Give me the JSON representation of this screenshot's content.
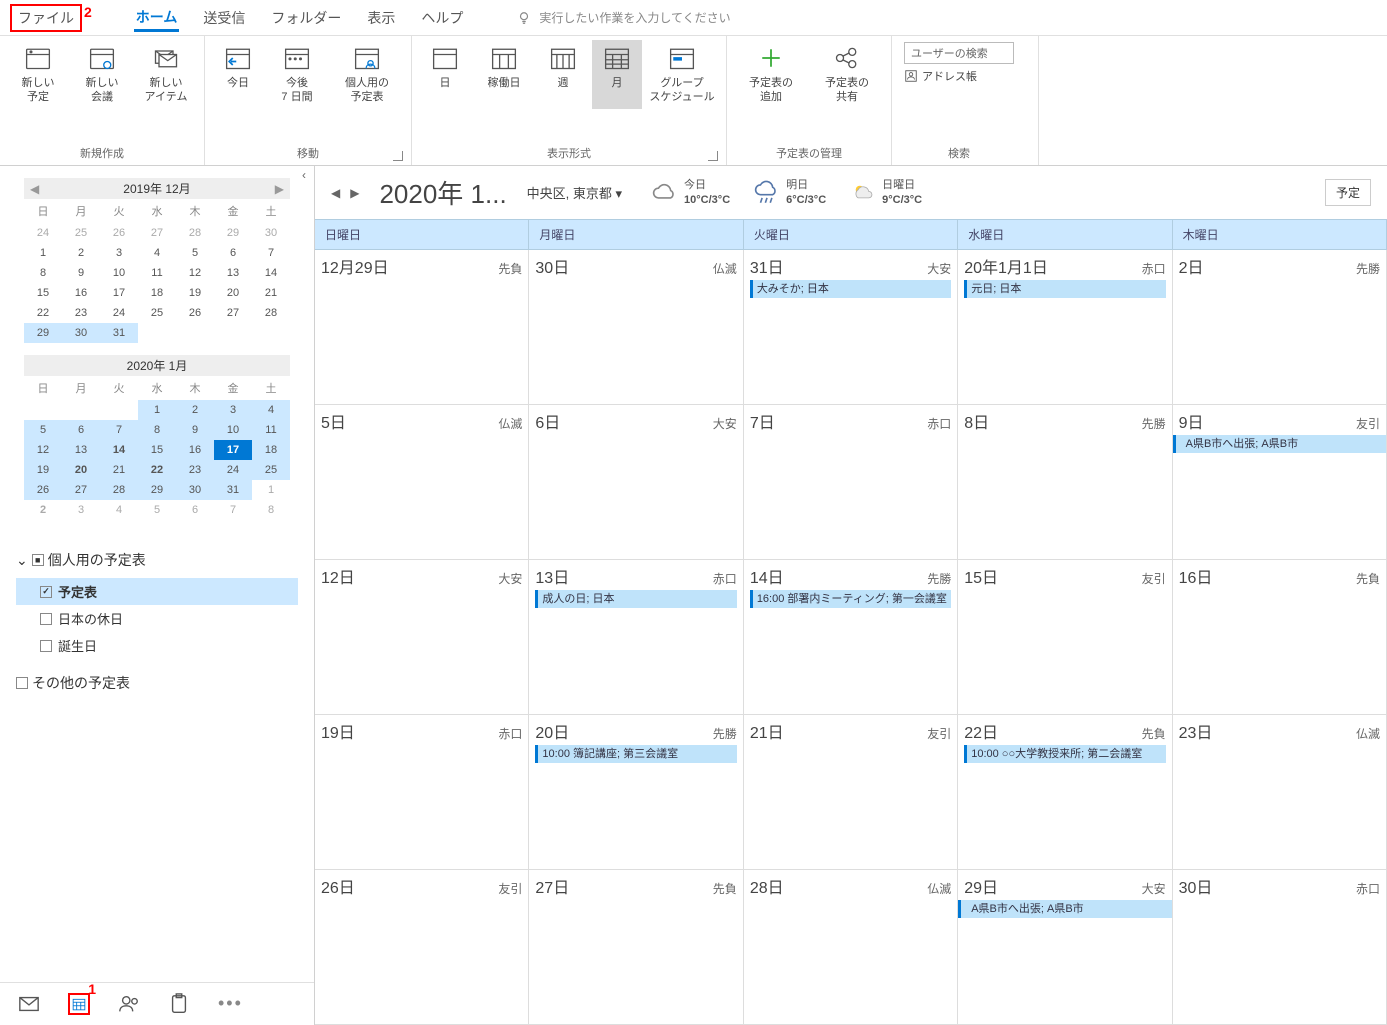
{
  "annotations": {
    "file_num": "2",
    "cal_num": "1"
  },
  "menu": {
    "file": "ファイル",
    "home": "ホーム",
    "sendreceive": "送受信",
    "folder": "フォルダー",
    "view": "表示",
    "help": "ヘルプ",
    "tellme": "実行したい作業を入力してください"
  },
  "ribbon": {
    "new": {
      "label": "新規作成",
      "appt": "新しい\n予定",
      "meeting": "新しい\n会議",
      "items": "新しい\nアイテム"
    },
    "goto": {
      "label": "移動",
      "today": "今日",
      "next7": "今後\n7 日間",
      "personal": "個人用の\n予定表"
    },
    "arrange": {
      "label": "表示形式",
      "day": "日",
      "workweek": "稼働日",
      "week": "週",
      "month": "月",
      "group": "グループ\nスケジュール"
    },
    "manage": {
      "label": "予定表の管理",
      "add": "予定表の\n追加",
      "share": "予定表の\n共有"
    },
    "search": {
      "label": "検索",
      "placeholder": "ユーザーの検索",
      "address": "アドレス帳"
    }
  },
  "minical1": {
    "title": "2019年 12月",
    "dow": [
      "日",
      "月",
      "火",
      "水",
      "木",
      "金",
      "土"
    ],
    "rows": [
      [
        "24",
        "25",
        "26",
        "27",
        "28",
        "29",
        "30"
      ],
      [
        "1",
        "2",
        "3",
        "4",
        "5",
        "6",
        "7"
      ],
      [
        "8",
        "9",
        "10",
        "11",
        "12",
        "13",
        "14"
      ],
      [
        "15",
        "16",
        "17",
        "18",
        "19",
        "20",
        "21"
      ],
      [
        "22",
        "23",
        "24",
        "25",
        "26",
        "27",
        "28"
      ],
      [
        "29",
        "30",
        "31",
        "",
        "",
        "",
        ""
      ]
    ]
  },
  "minical2": {
    "title": "2020年 1月",
    "dow": [
      "日",
      "月",
      "火",
      "水",
      "木",
      "金",
      "土"
    ],
    "rows": [
      [
        "",
        "",
        "",
        "1",
        "2",
        "3",
        "4"
      ],
      [
        "5",
        "6",
        "7",
        "8",
        "9",
        "10",
        "11"
      ],
      [
        "12",
        "13",
        "14",
        "15",
        "16",
        "17",
        "18"
      ],
      [
        "19",
        "20",
        "21",
        "22",
        "23",
        "24",
        "25"
      ],
      [
        "26",
        "27",
        "28",
        "29",
        "30",
        "31",
        "1"
      ],
      [
        "2",
        "3",
        "4",
        "5",
        "6",
        "7",
        "8"
      ]
    ]
  },
  "callist": {
    "group1": "個人用の予定表",
    "cal1": "予定表",
    "cal2": "日本の休日",
    "cal3": "誕生日",
    "group2": "その他の予定表"
  },
  "mainhdr": {
    "title": "2020年 1...",
    "location": "中央区, 東京都",
    "tab": "予定",
    "weather": [
      {
        "label": "今日",
        "temp": "10°C/3°C"
      },
      {
        "label": "明日",
        "temp": "6°C/3°C"
      },
      {
        "label": "日曜日",
        "temp": "9°C/3°C"
      }
    ]
  },
  "dayheaders": [
    "日曜日",
    "月曜日",
    "火曜日",
    "水曜日",
    "木曜日"
  ],
  "weeks": [
    [
      {
        "date": "12月29日",
        "rk": "先負"
      },
      {
        "date": "30日",
        "rk": "仏滅"
      },
      {
        "date": "31日",
        "rk": "大安",
        "ev": "大みそか; 日本"
      },
      {
        "date": "20年1月1日",
        "rk": "赤口",
        "ev": "元日; 日本"
      },
      {
        "date": "2日",
        "rk": "先勝"
      }
    ],
    [
      {
        "date": "5日",
        "rk": "仏滅"
      },
      {
        "date": "6日",
        "rk": "大安"
      },
      {
        "date": "7日",
        "rk": "赤口"
      },
      {
        "date": "8日",
        "rk": "先勝"
      },
      {
        "date": "9日",
        "rk": "友引",
        "ev": "A県B市へ出張; A県B市",
        "span": true
      }
    ],
    [
      {
        "date": "12日",
        "rk": "大安"
      },
      {
        "date": "13日",
        "rk": "赤口",
        "ev": "成人の日; 日本"
      },
      {
        "date": "14日",
        "rk": "先勝",
        "ev": "16:00 部署内ミーティング; 第一会議室"
      },
      {
        "date": "15日",
        "rk": "友引"
      },
      {
        "date": "16日",
        "rk": "先負"
      }
    ],
    [
      {
        "date": "19日",
        "rk": "赤口"
      },
      {
        "date": "20日",
        "rk": "先勝",
        "ev": "10:00 簿記講座; 第三会議室"
      },
      {
        "date": "21日",
        "rk": "友引"
      },
      {
        "date": "22日",
        "rk": "先負",
        "ev": "10:00 ○○大学教授来所; 第二会議室"
      },
      {
        "date": "23日",
        "rk": "仏滅"
      }
    ],
    [
      {
        "date": "26日",
        "rk": "友引"
      },
      {
        "date": "27日",
        "rk": "先負"
      },
      {
        "date": "28日",
        "rk": "仏滅"
      },
      {
        "date": "29日",
        "rk": "大安",
        "ev": "A県B市へ出張; A県B市",
        "span": true
      },
      {
        "date": "30日",
        "rk": "赤口"
      }
    ]
  ]
}
